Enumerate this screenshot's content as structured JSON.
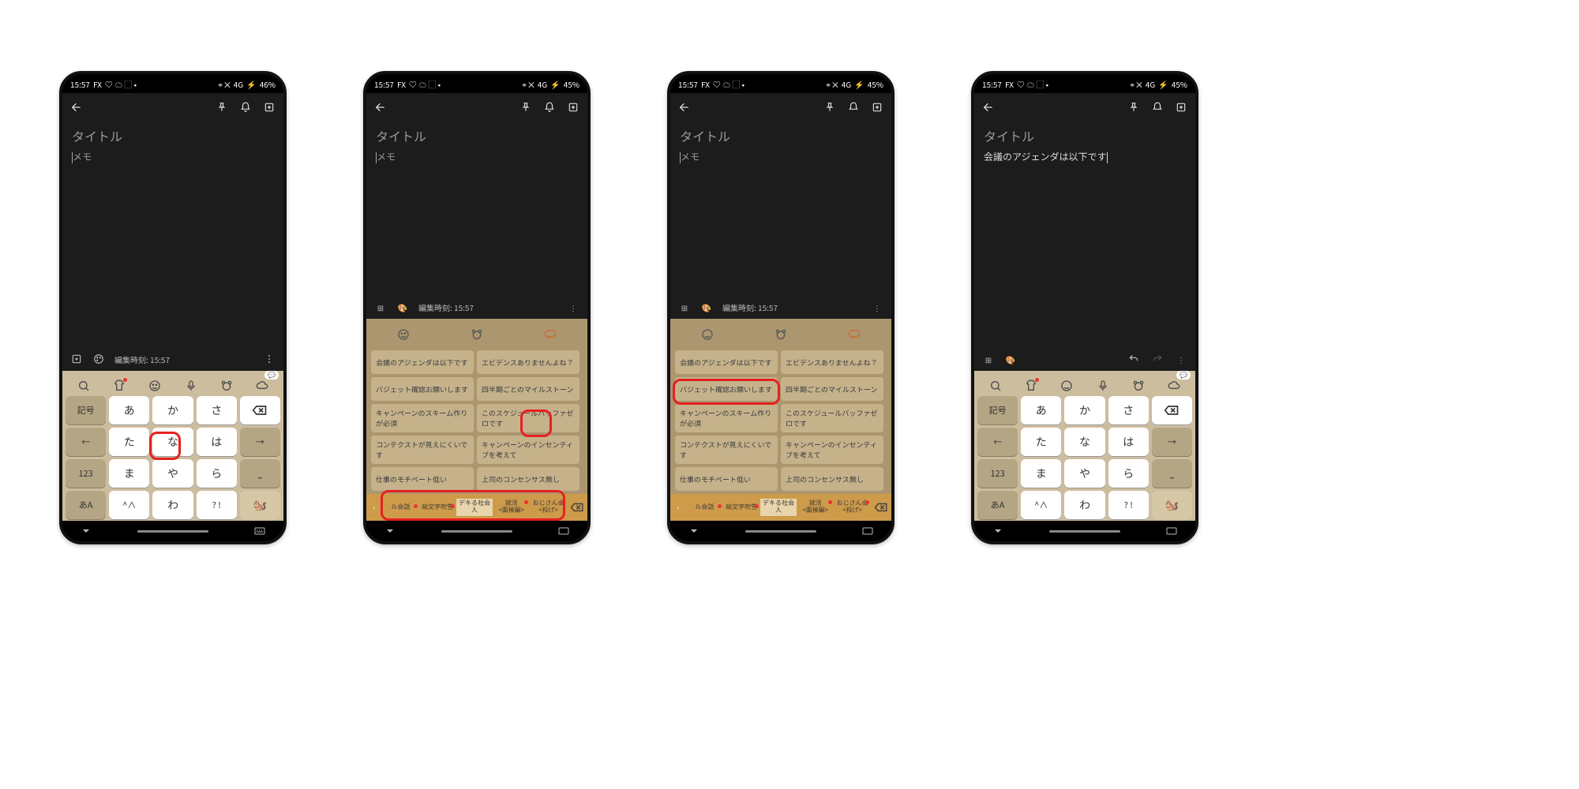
{
  "status": {
    "time": "15:57",
    "fx": "FX",
    "net": "4G",
    "bat1": "46%",
    "bat2": "45%"
  },
  "app": {
    "title_ph": "タイトル",
    "body_ph": "メモ",
    "edit_prefix": "編集時刻: 15:57"
  },
  "note4": "会議のアジェンダは以下です",
  "kana": {
    "r1": [
      "記号",
      "あ",
      "か",
      "さ"
    ],
    "r2": [
      "←",
      "た",
      "な",
      "は",
      "→"
    ],
    "r3": [
      "123",
      "ま",
      "や",
      "ら"
    ],
    "r4": [
      "あA",
      "^∧",
      "わ",
      "? !"
    ],
    "space": "␣"
  },
  "phrases": [
    "会議のアジェンダは以下です",
    "エビデンスありませんよね？",
    "バジェット確認お願いします",
    "四半期ごとのマイルストーン",
    "キャンペーンのスキーム作りが必須",
    "このスケジュールバッファゼロです",
    "コンテクストが見えにくいです",
    "キャンペーンのインセンティブを考えて",
    "仕事のモチベート低い",
    "上司のコンセンサス無し"
  ],
  "cats": [
    "ル会話",
    "絵文字吹雪",
    "デキる社会人",
    "就活\n<面接編>",
    "おじさん会\n<投げ>"
  ]
}
